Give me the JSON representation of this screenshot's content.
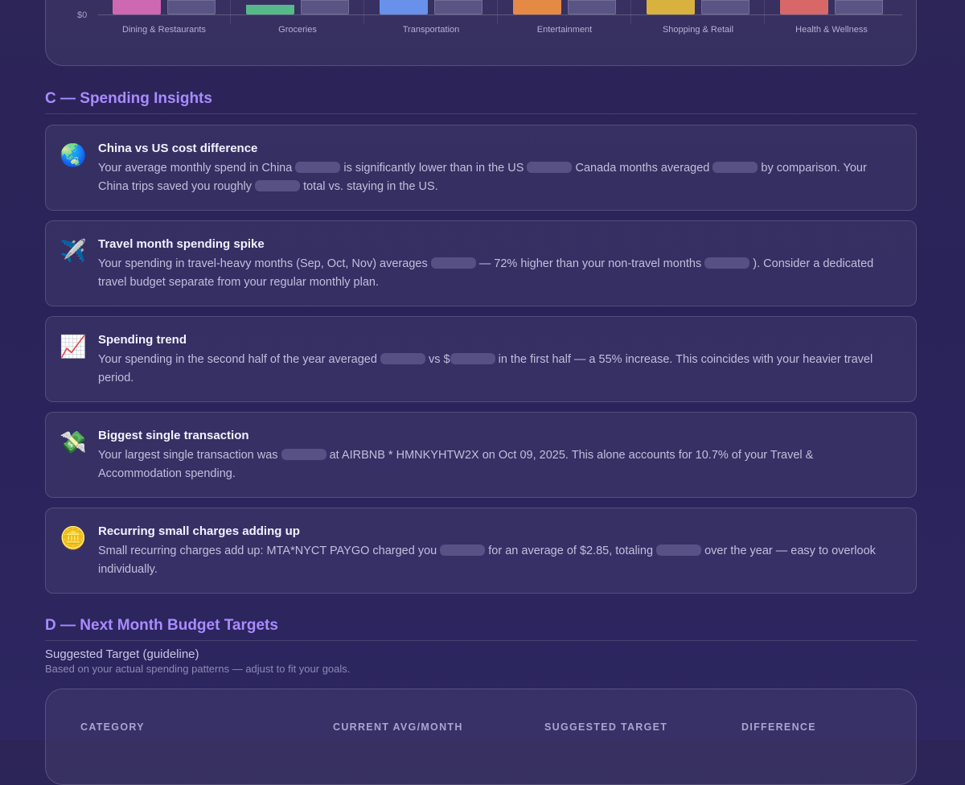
{
  "chart": {
    "zero_label": "$0",
    "categories": [
      {
        "label": "Dining & Restaurants",
        "color": "#cf68b2"
      },
      {
        "label": "Groceries",
        "color": "#57b98a"
      },
      {
        "label": "Transportation",
        "color": "#6791ea"
      },
      {
        "label": "Entertainment",
        "color": "#e58a44"
      },
      {
        "label": "Shopping & Retail",
        "color": "#d8b13f"
      },
      {
        "label": "Health & Wellness",
        "color": "#d86868"
      }
    ],
    "comparison_bar_color": "#5a5485"
  },
  "section_c": {
    "title": "C — Spending Insights",
    "insights": [
      {
        "icon": "🌏",
        "title": "China vs US cost difference",
        "parts": [
          "Your average monthly spend in China ",
          "is significantly lower than in the US ",
          " Canada months averaged ",
          "by comparison. Your China trips saved you roughly ",
          "total vs. staying in the US."
        ]
      },
      {
        "icon": "✈️",
        "title": "Travel month spending spike",
        "parts": [
          "Your spending in travel-heavy months (Sep, Oct, Nov) averages ",
          "— 72% higher than your non-travel months ",
          "). Consider a dedicated travel budget separate from your regular monthly plan."
        ]
      },
      {
        "icon": "📈",
        "title": "Spending trend",
        "parts": [
          "Your spending in the second half of the year averaged ",
          "vs $",
          "in the first half — a 55% increase. This coincides with your heavier travel period."
        ]
      },
      {
        "icon": "💸",
        "title": "Biggest single transaction",
        "parts": [
          "Your largest single transaction was ",
          "at AIRBNB * HMNKYHTW2X on Oct 09, 2025. This alone accounts for 10.7% of your Travel & Accommodation spending."
        ]
      },
      {
        "icon": "🪙",
        "title": "Recurring small charges adding up",
        "parts": [
          "Small recurring charges add up: MTA*NYCT PAYGO charged you ",
          "for an average of $2.85, totaling ",
          "over the year — easy to overlook individually."
        ]
      }
    ]
  },
  "section_d": {
    "title": "D — Next Month Budget Targets",
    "subhead": "Suggested Target (guideline)",
    "note": "Based on your actual spending patterns — adjust to fit your goals.",
    "headers": [
      "CATEGORY",
      "CURRENT AVG/MONTH",
      "SUGGESTED TARGET",
      "DIFFERENCE"
    ]
  }
}
